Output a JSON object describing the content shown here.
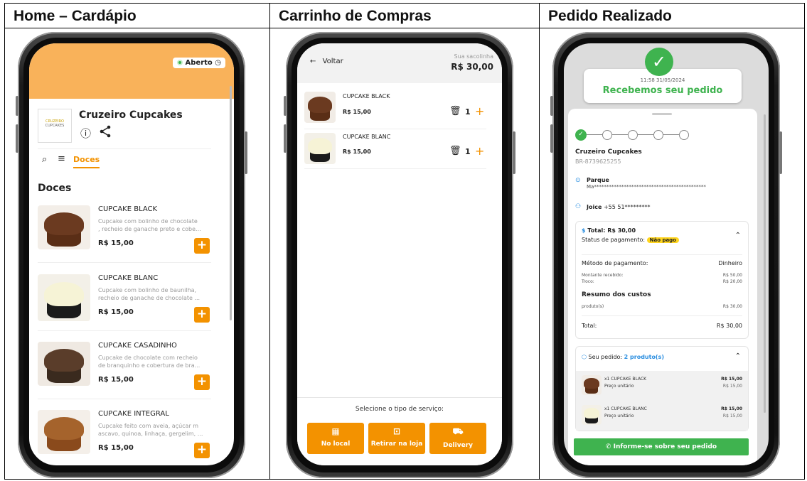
{
  "columns": [
    {
      "title": "Home – Cardápio"
    },
    {
      "title": "Carrinho de Compras"
    },
    {
      "title": "Pedido Realizado"
    }
  ],
  "home": {
    "status_badge": "Aberto",
    "store_name": "Cruzeiro Cupcakes",
    "logo_text_top": "CRUZEIRO",
    "logo_text_bottom": "CUPCAKES",
    "active_tab": "Doces",
    "section_title": "Doces",
    "products": [
      {
        "name": "CUPCAKE BLACK",
        "desc1": "Cupcake com bolinho de chocolate",
        "desc2": ", recheio de ganache preto e cobe...",
        "price": "R$ 15,00"
      },
      {
        "name": "CUPCAKE BLANC",
        "desc1": "Cupcake com bolinho de baunilha,",
        "desc2": "recheio de ganache de chocolate ...",
        "price": "R$ 15,00"
      },
      {
        "name": "CUPCAKE CASADINHO",
        "desc1": "Cupcake de chocolate com recheio",
        "desc2": "de branquinho e cobertura de bra...",
        "price": "R$ 15,00"
      },
      {
        "name": "CUPCAKE INTEGRAL",
        "desc1": "Cupcake feito com aveia, açúcar m",
        "desc2": "ascavo, quinoa, linhaça, gergelim, ...",
        "price": "R$ 15,00"
      }
    ]
  },
  "cart": {
    "back_label": "Voltar",
    "bag_label": "Sua sacolinha",
    "bag_total": "R$ 30,00",
    "items": [
      {
        "name": "CUPCAKE BLACK",
        "price": "R$ 15,00",
        "qty": "1"
      },
      {
        "name": "CUPCAKE BLANC",
        "price": "R$ 15,00",
        "qty": "1"
      }
    ],
    "service_prompt": "Selecione o tipo de serviço:",
    "services": [
      "No local",
      "Retirar na loja",
      "Delivery"
    ]
  },
  "order": {
    "timestamp": "11:58 31/05/2024",
    "received": "Recebemos seu pedido",
    "store_name": "Cruzeiro Cupcakes",
    "order_id": "BR-8739625255",
    "address_line1": "Parque",
    "address_line2": "Ma*********************************************",
    "customer": "Joice",
    "phone": "+55 51*********",
    "total_label": "Total: R$ 30,00",
    "payment_status_label": "Status de pagamento:",
    "payment_status": "Não pago",
    "method_label": "Método de pagamento:",
    "method_value": "Dinheiro",
    "received_label": "Montante recebido:",
    "received_value": "R$ 50,00",
    "change_label": "Troco:",
    "change_value": "R$ 20,00",
    "summary_title": "Resumo dos custos",
    "products_label": "produto(s)",
    "products_value": "R$ 30,00",
    "total2_label": "Total:",
    "total2_value": "R$ 30,00",
    "your_order_label": "Seu pedido:",
    "your_order_count": "2 produto(s)",
    "items": [
      {
        "name": "x1 CUPCAKE BLACK",
        "unit_label": "Preço unitário",
        "price": "R$ 15,00",
        "unit_price": "R$ 15,00"
      },
      {
        "name": "x1 CUPCAKE BLANC",
        "unit_label": "Preço unitário",
        "price": "R$ 15,00",
        "unit_price": "R$ 15,00"
      }
    ],
    "info_button": "Informe-se sobre seu pedido"
  },
  "colors": {
    "accent": "#f39200",
    "success": "#3fb34f",
    "header_orange": "#f9b25a"
  }
}
